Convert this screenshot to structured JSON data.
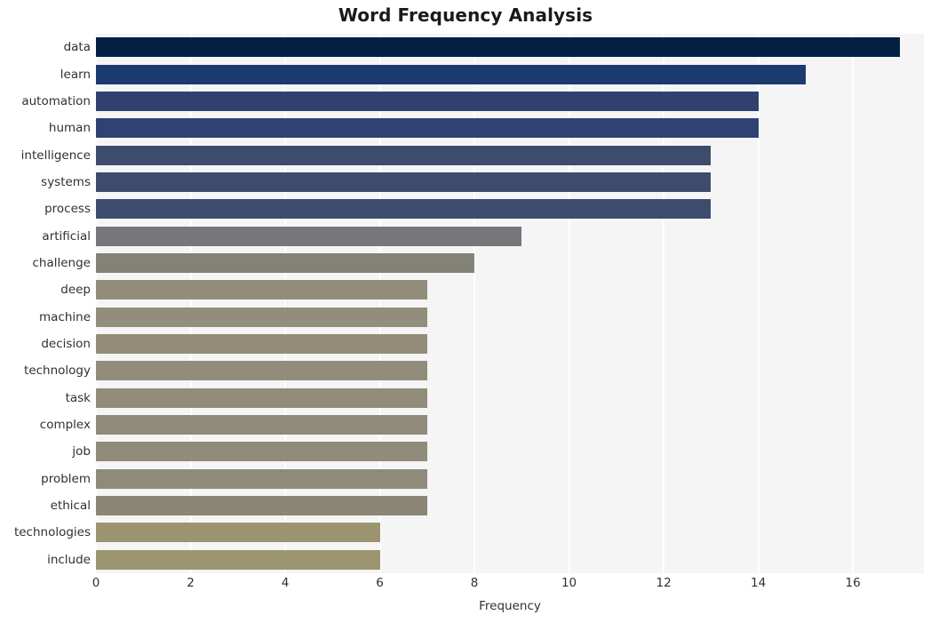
{
  "chart_data": {
    "type": "bar",
    "orientation": "horizontal",
    "title": "Word Frequency Analysis",
    "xlabel": "Frequency",
    "ylabel": "",
    "xlim": [
      0,
      17.5
    ],
    "ylim_categories": 20,
    "grid": true,
    "grid_axis": "x",
    "legend": null,
    "categories": [
      "data",
      "learn",
      "automation",
      "human",
      "intelligence",
      "systems",
      "process",
      "artificial",
      "challenge",
      "deep",
      "machine",
      "decision",
      "technology",
      "task",
      "complex",
      "job",
      "problem",
      "ethical",
      "technologies",
      "include"
    ],
    "values": [
      17,
      15,
      14,
      14,
      13,
      13,
      13,
      9,
      8,
      7,
      7,
      7,
      7,
      7,
      7,
      7,
      7,
      7,
      6,
      6
    ],
    "bar_colors": [
      "#031f44",
      "#1d3a6e",
      "#30406f",
      "#2f4272",
      "#3d4c6b",
      "#3d4c6d",
      "#3d4c6d",
      "#76777a",
      "#838278",
      "#938d7b",
      "#938e7c",
      "#938d7a",
      "#928d7b",
      "#928d7b",
      "#8f8a79",
      "#908b7a",
      "#8f8a79",
      "#8b8675",
      "#9c9470",
      "#9d9570"
    ],
    "xticks": [
      0,
      2,
      4,
      6,
      8,
      10,
      12,
      14,
      16
    ],
    "xtick_labels": [
      "0",
      "2",
      "4",
      "6",
      "8",
      "10",
      "12",
      "14",
      "16"
    ],
    "plot_background": "#f5f5f6",
    "grid_color": "#ffffff",
    "figure_background": "#ffffff",
    "text_color": "#303030",
    "title_color": "#1a1a1a"
  }
}
